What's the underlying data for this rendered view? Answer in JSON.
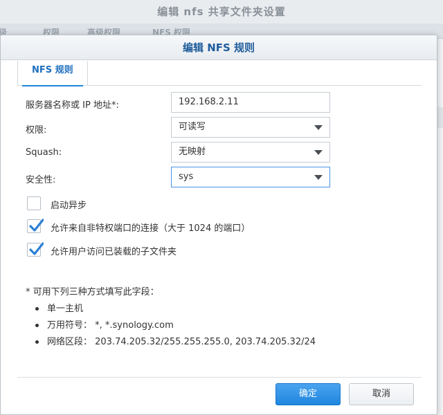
{
  "background_window": {
    "title": "编辑 nfs 共享文件夹设置",
    "tabs": [
      "高级",
      "权限",
      "高级权限",
      "NFS 权限"
    ]
  },
  "dialog": {
    "title": "编辑 NFS 规则",
    "tab": "NFS 规则",
    "fields": {
      "server_label": "服务器名称或 IP 地址*:",
      "server_value": "192.168.2.11",
      "privilege_label": "权限:",
      "privilege_value": "可读写",
      "squash_label": "Squash:",
      "squash_value": "无映射",
      "security_label": "安全性:",
      "security_value": "sys"
    },
    "checkboxes": [
      {
        "label": "启动异步",
        "checked": false
      },
      {
        "label": "允许来自非特权端口的连接（大于 1024 的端口）",
        "checked": true
      },
      {
        "label": "允许用户访问已装载的子文件夹",
        "checked": true
      }
    ],
    "note": {
      "heading": "* 可用下列三种方式填写此字段：",
      "items": [
        "单一主机",
        "万用符号： *, *.synology.com",
        "网络区段： 203.74.205.32/255.255.255.0, 203.74.205.32/24"
      ]
    },
    "buttons": {
      "ok": "确定",
      "cancel": "取消"
    }
  },
  "colors": {
    "accent": "#1e84d8",
    "title_blue": "#1f5c9c",
    "check_blue": "#2a7fd4"
  }
}
